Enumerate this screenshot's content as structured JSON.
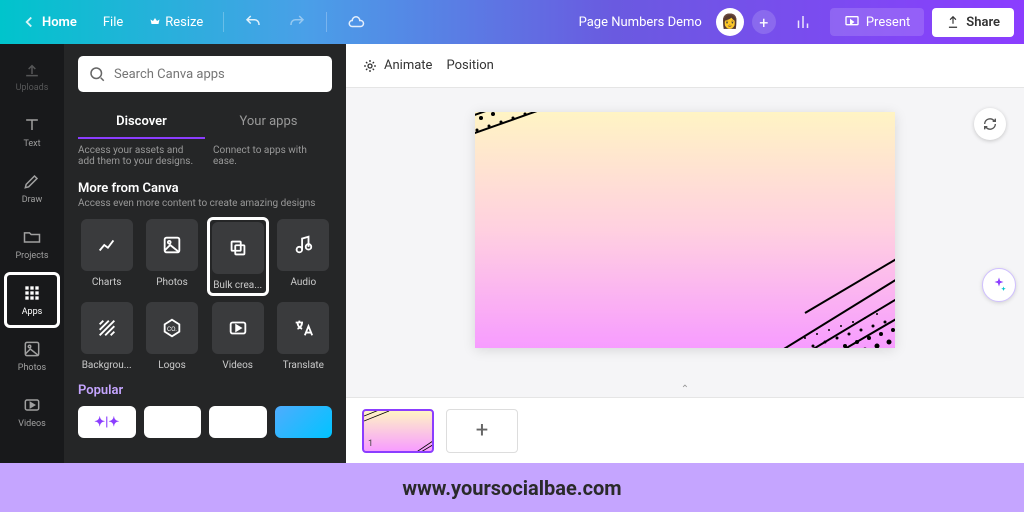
{
  "topbar": {
    "home": "Home",
    "file": "File",
    "resize": "Resize",
    "project_name": "Page Numbers Demo",
    "present": "Present",
    "share": "Share"
  },
  "sidenav": {
    "uploads": "Uploads",
    "text": "Text",
    "draw": "Draw",
    "projects": "Projects",
    "apps": "Apps",
    "photos": "Photos",
    "videos": "Videos"
  },
  "panel": {
    "search_placeholder": "Search Canva apps",
    "tab_discover": "Discover",
    "tab_yourapps": "Your apps",
    "sub_left": "Access your assets and add them to your designs.",
    "sub_right": "Connect to apps with ease.",
    "section_title": "More from Canva",
    "section_desc": "Access even more content to create amazing designs",
    "apps": {
      "charts": "Charts",
      "photos": "Photos",
      "bulk": "Bulk crea...",
      "audio": "Audio",
      "background": "Backgrou...",
      "logos": "Logos",
      "videos": "Videos",
      "translate": "Translate"
    },
    "popular": "Popular"
  },
  "canvas": {
    "animate": "Animate",
    "position": "Position",
    "thumb_num": "1"
  },
  "footer": {
    "url": "www.yoursocialbae.com"
  }
}
